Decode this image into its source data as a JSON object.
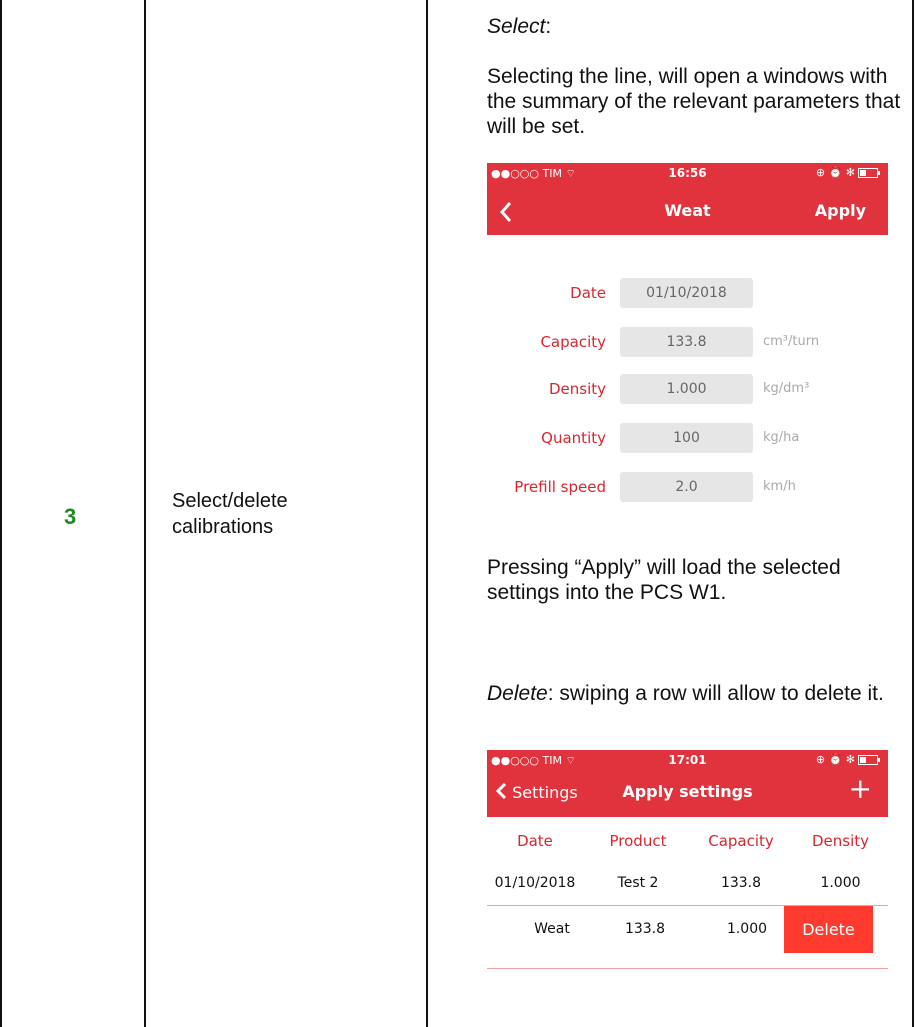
{
  "row": {
    "number": "3",
    "label_line1": "Select/delete",
    "label_line2": "calibrations"
  },
  "content": {
    "select_heading": "Select",
    "select_colon": ":",
    "select_text": "Selecting the line, will open a windows with the summary of the relevant parameters that will be set.",
    "apply_text": "Pressing “Apply” will load the selected settings into the PCS W1.",
    "delete_heading": "Delete",
    "delete_text": ": swiping a row will allow to delete it."
  },
  "screen1": {
    "carrier": "●●○○○ TIM",
    "wifi": "⌔",
    "time": "16:56",
    "status_icons": "⊕ ⏰ ✻",
    "back_icon": "chevron-left",
    "title": "Weat",
    "apply": "Apply",
    "fields": [
      {
        "label": "Date",
        "value": "01/10/2018",
        "unit": ""
      },
      {
        "label": "Capacity",
        "value": "133.8",
        "unit": "cm³/turn"
      },
      {
        "label": "Density",
        "value": "1.000",
        "unit": "kg/dm³"
      },
      {
        "label": "Quantity",
        "value": "100",
        "unit": "kg/ha"
      },
      {
        "label": "Prefill speed",
        "value": "2.0",
        "unit": "km/h"
      }
    ]
  },
  "screen2": {
    "carrier": "●●○○○ TIM",
    "wifi": "⌔",
    "time": "17:01",
    "status_icons": "⊕ ⏰ ✻",
    "back_label": "Settings",
    "title": "Apply settings",
    "add": "+",
    "headers": [
      "Date",
      "Product",
      "Capacity",
      "Density"
    ],
    "row1": [
      "01/10/2018",
      "Test 2",
      "133.8",
      "1.000"
    ],
    "row2": [
      "Weat",
      "133.8",
      "1.000"
    ],
    "delete_label": "Delete"
  },
  "colors": {
    "accent_red": "#e0333d",
    "label_red": "#d8262e",
    "step_green": "#1f8a1f",
    "delete_red": "#ff3b30"
  }
}
